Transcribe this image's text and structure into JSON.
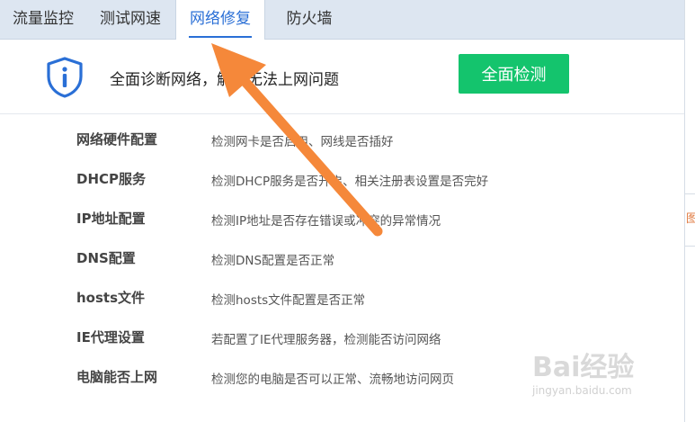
{
  "tabs": [
    {
      "label": "流量监控",
      "active": false
    },
    {
      "label": "测试网速",
      "active": false
    },
    {
      "label": "网络修复",
      "active": true
    },
    {
      "label": "防火墙",
      "active": false
    }
  ],
  "header": {
    "title": "全面诊断网络，解决无法上网问题",
    "scan_button": "全面检测"
  },
  "items": [
    {
      "name": "网络硬件配置",
      "desc": "检测网卡是否启用、网线是否插好"
    },
    {
      "name": "DHCP服务",
      "desc": "检测DHCP服务是否开启、相关注册表设置是否完好"
    },
    {
      "name": "IP地址配置",
      "desc": "检测IP地址是否存在错误或冲突的异常情况"
    },
    {
      "name": "DNS配置",
      "desc": "检测DNS配置是否正常"
    },
    {
      "name": "hosts文件",
      "desc": "检测hosts文件配置是否正常"
    },
    {
      "name": "IE代理设置",
      "desc": "若配置了IE代理服务器，检测能否访问网络"
    },
    {
      "name": "电脑能否上网",
      "desc": "检测您的电脑是否可以正常、流畅地访问网页"
    }
  ],
  "edge_text": "图",
  "watermark": {
    "logo": "Bai经验",
    "url": "jingyan.baidu.com"
  },
  "colors": {
    "accent": "#2a6fd6",
    "button": "#14c46d",
    "arrow": "#f5883a"
  }
}
